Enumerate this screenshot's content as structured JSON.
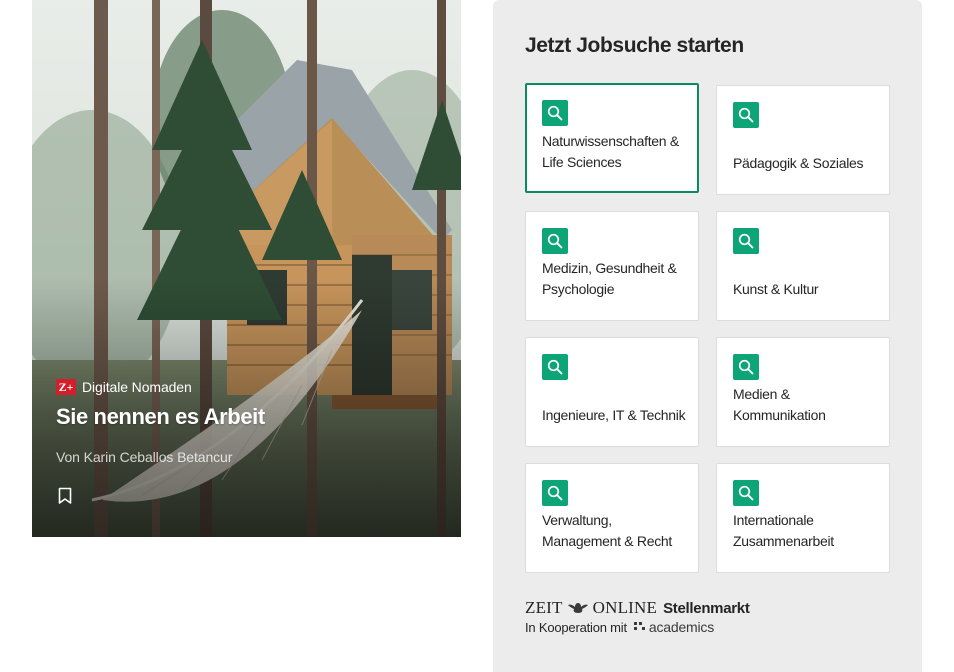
{
  "teaser": {
    "badge": "Z+",
    "kicker": "Digitale Nomaden",
    "headline": "Sie nennen es Arbeit",
    "byline": "Von Karin Ceballos Betancur"
  },
  "jobs": {
    "title": "Jetzt Jobsuche starten",
    "accent_color": "#0da477",
    "active_border_color": "#0a8a63",
    "categories": [
      {
        "label": "Naturwissenschaften & Life Sciences",
        "active": true
      },
      {
        "label": "Pädagogik & Soziales",
        "active": false
      },
      {
        "label": "Medizin, Gesundheit & Psychologie",
        "active": false
      },
      {
        "label": "Kunst & Kultur",
        "active": false
      },
      {
        "label": "Ingenieure, IT & Technik",
        "active": false
      },
      {
        "label": "Medien & Kommunikation",
        "active": false
      },
      {
        "label": "Verwaltung, Management & Recht",
        "active": false
      },
      {
        "label": "Internationale Zusammenarbeit",
        "active": false
      }
    ],
    "brand": {
      "zeit": "ZEIT",
      "online": "ONLINE",
      "stellenmarkt": "Stellenmarkt",
      "cooperation": "In Kooperation mit",
      "partner": "academics"
    }
  },
  "icons": {
    "search": "search-icon",
    "bookmark": "bookmark-icon",
    "eagle": "zeit-eagle-icon",
    "academics_mark": "academics-logo-icon"
  }
}
